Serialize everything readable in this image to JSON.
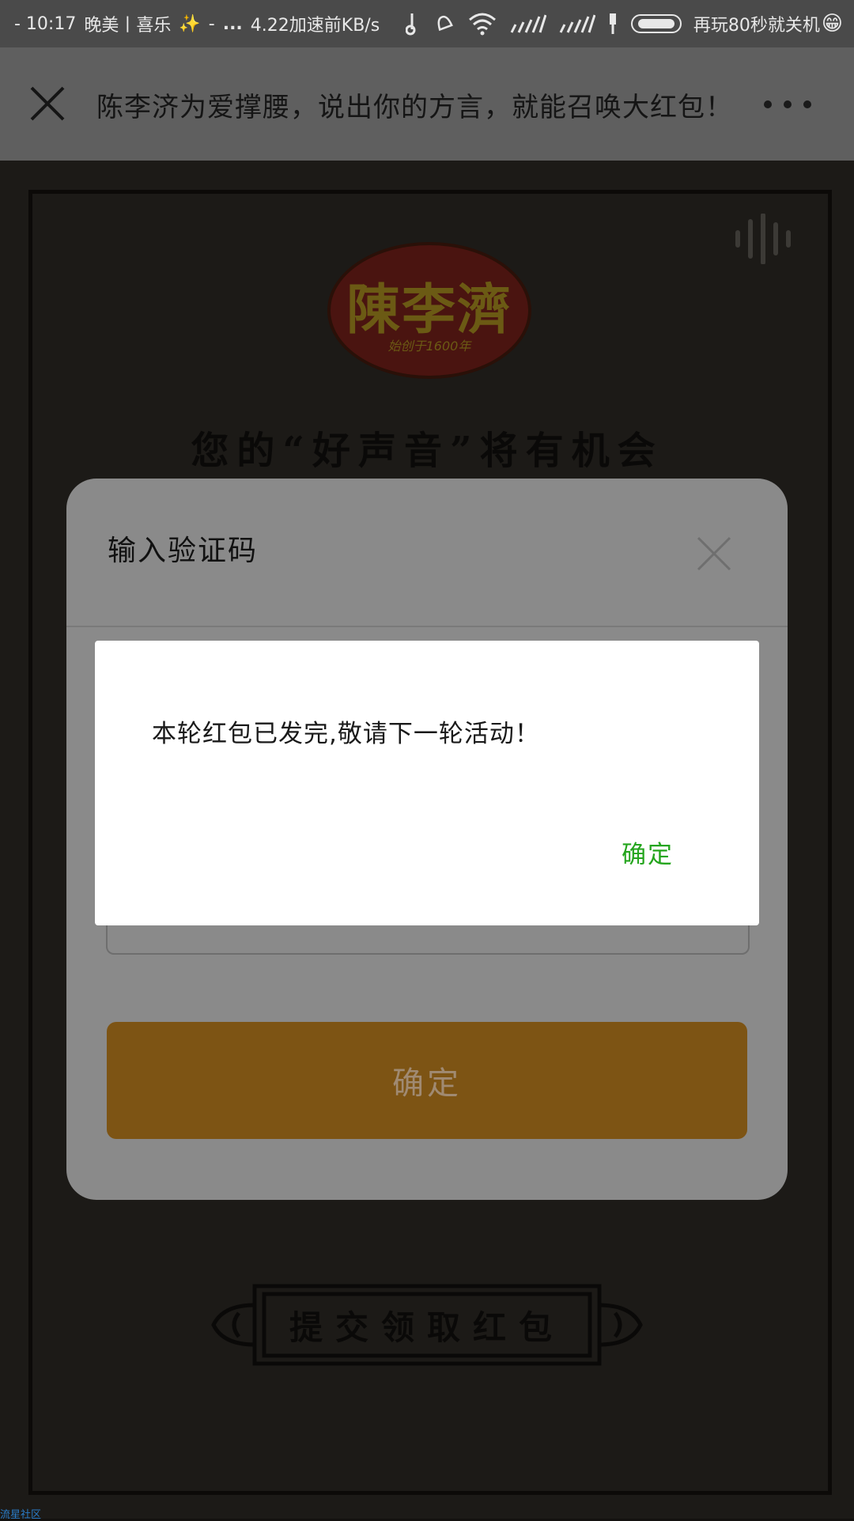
{
  "status_bar": {
    "time": "- 10:17",
    "carrier": "晚美丨喜乐",
    "sparkle": "✨",
    "dash": "-",
    "ellipsis": "...",
    "speed": "4.22加速前KB/s",
    "battery_msg": "再玩80秒就关机",
    "emoji": "😁"
  },
  "nav": {
    "title": "陈李济为爱撑腰，说出你的方言，就能召唤大红包！"
  },
  "page": {
    "logo_text": "陳李濟",
    "logo_sub": "始创于1600年",
    "headline": "您的“好声音”将有机会",
    "submit_label": "提交领取红包",
    "watermark": "流星社区"
  },
  "verify_modal": {
    "title": "输入验证码",
    "confirm_label": "确定"
  },
  "alert": {
    "message": "本轮红包已发完,敬请下一轮活动！",
    "ok_label": "确定"
  },
  "colors": {
    "accent_green": "#24a51d",
    "button_gold": "#7d5414"
  }
}
